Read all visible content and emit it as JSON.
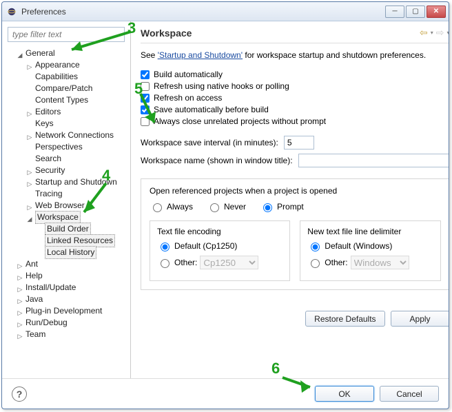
{
  "window": {
    "title": "Preferences"
  },
  "filter": {
    "placeholder": "type filter text"
  },
  "tree": {
    "general": "General",
    "general_children": [
      "Appearance",
      "Capabilities",
      "Compare/Patch",
      "Content Types",
      "Editors",
      "Keys",
      "Network Connections",
      "Perspectives",
      "Search",
      "Security",
      "Startup and Shutdown",
      "Tracing",
      "Web Browser"
    ],
    "workspace": "Workspace",
    "workspace_children": [
      "Build Order",
      "Linked Resources",
      "Local History"
    ],
    "roots": [
      "Ant",
      "Help",
      "Install/Update",
      "Java",
      "Plug-in Development",
      "Run/Debug",
      "Team"
    ]
  },
  "page": {
    "title": "Workspace",
    "intro_prefix": "See ",
    "intro_link": "'Startup and Shutdown'",
    "intro_suffix": " for workspace startup and shutdown preferences."
  },
  "checks": {
    "build_auto": "Build automatically",
    "refresh_native": "Refresh using native hooks or polling",
    "refresh_access": "Refresh on access",
    "save_before_build": "Save automatically before build",
    "close_unrelated": "Always close unrelated projects without prompt"
  },
  "fields": {
    "save_interval_label": "Workspace save interval (in minutes):",
    "save_interval_value": "5",
    "ws_name_label": "Workspace name (shown in window title):",
    "ws_name_value": ""
  },
  "open_ref": {
    "label": "Open referenced projects when a project is opened",
    "always": "Always",
    "never": "Never",
    "prompt": "Prompt"
  },
  "encoding": {
    "hdr": "Text file encoding",
    "default": "Default (Cp1250)",
    "other": "Other:",
    "other_value": "Cp1250"
  },
  "delimiter": {
    "hdr": "New text file line delimiter",
    "default": "Default (Windows)",
    "other": "Other:",
    "other_value": "Windows"
  },
  "buttons": {
    "restore": "Restore Defaults",
    "apply": "Apply",
    "ok": "OK",
    "cancel": "Cancel"
  },
  "anno": {
    "n3": "3",
    "n4": "4",
    "n5": "5",
    "n6": "6"
  }
}
